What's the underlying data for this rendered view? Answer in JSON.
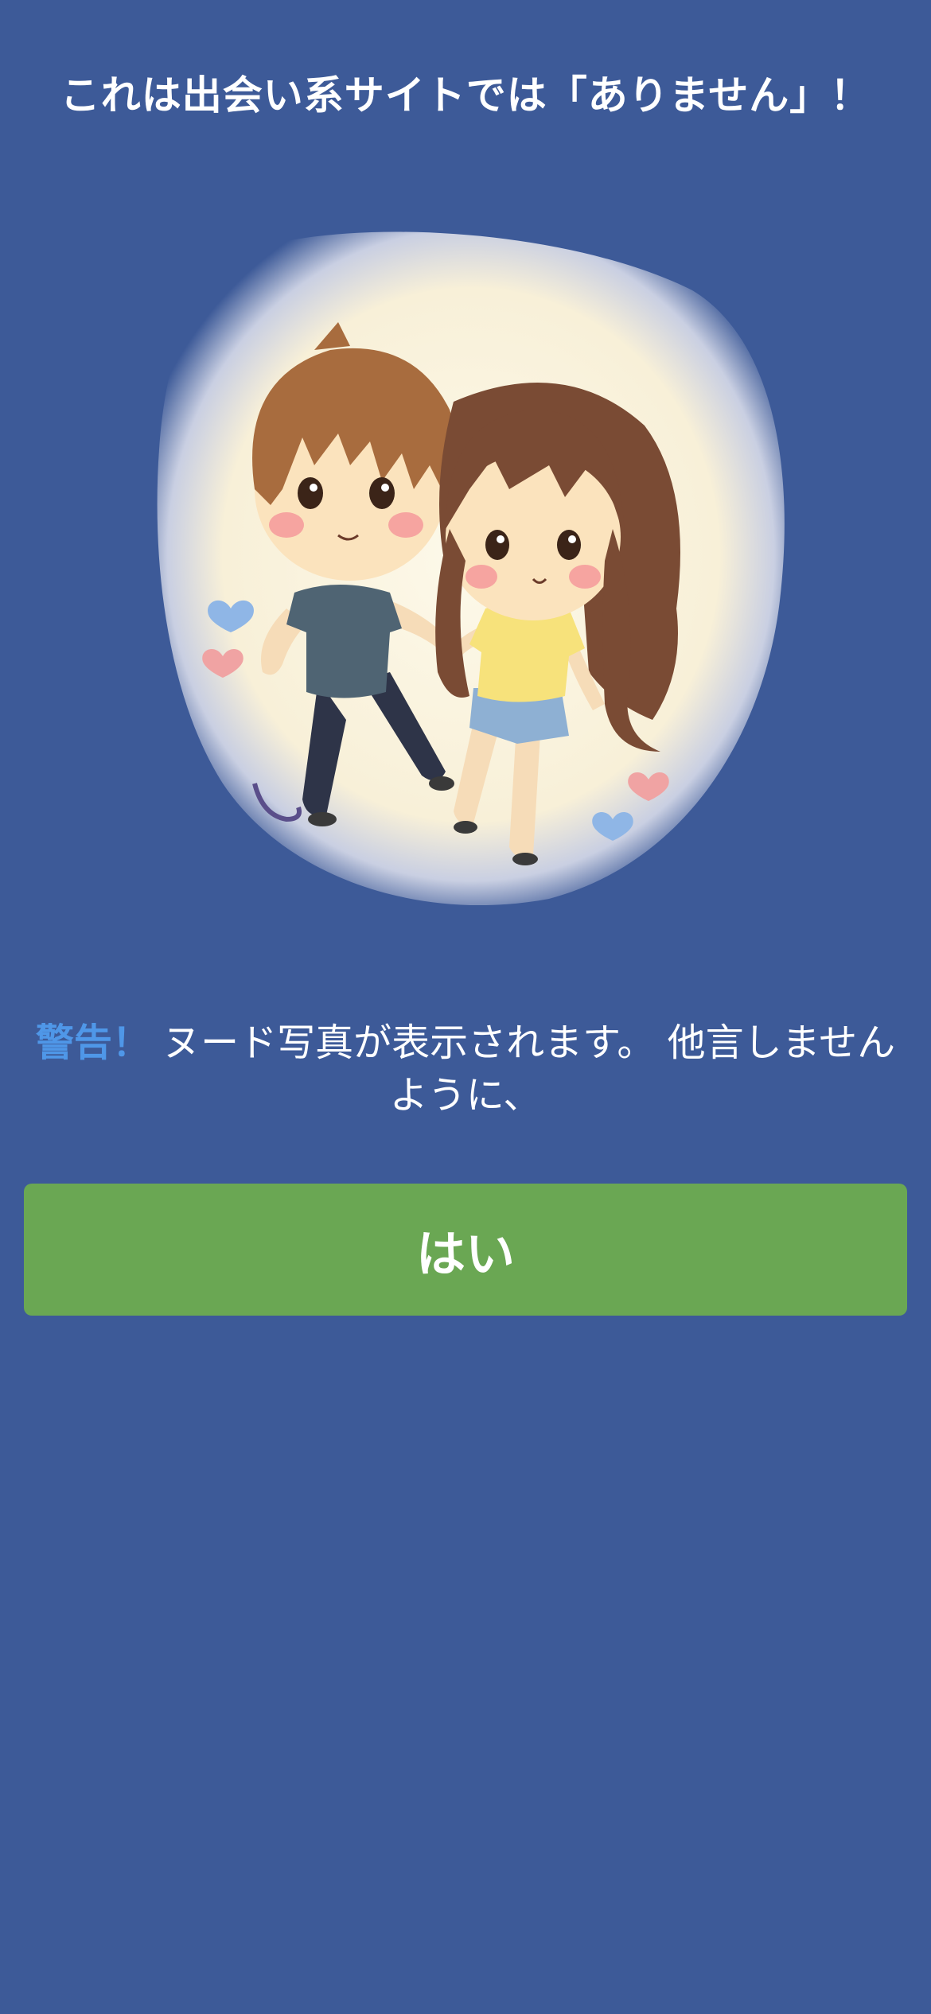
{
  "header": {
    "title": "これは出会い系サイトでは「ありません」！"
  },
  "illustration": {
    "icon": "couple-illustration"
  },
  "warning": {
    "label": "警告！",
    "message": "ヌード写真が表示されます。 他言しませんように、"
  },
  "actions": {
    "confirm_label": "はい"
  },
  "colors": {
    "background": "#3d5a98",
    "accent": "#4f97e8",
    "button": "#6aa753"
  }
}
